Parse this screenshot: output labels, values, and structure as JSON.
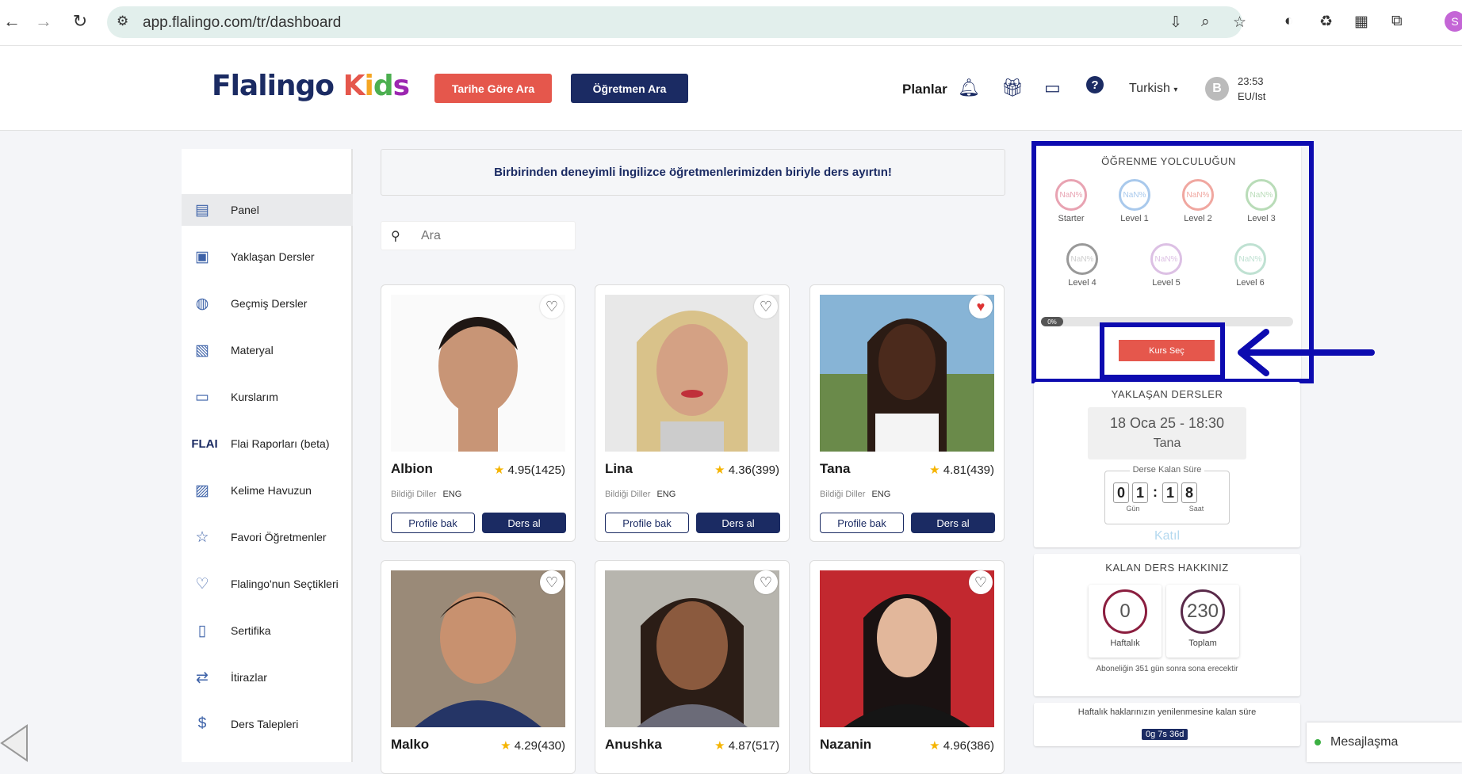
{
  "browser": {
    "url": "app.flalingo.com/tr/dashboard",
    "profile_initial": "S"
  },
  "header": {
    "logo": "Flalingo Kids",
    "btn_date_search": "Tarihe Göre Ara",
    "btn_teacher_search": "Öğretmen Ara",
    "plans": "Planlar",
    "language": "Turkish",
    "avatar_initial": "B",
    "time": "23:53",
    "timezone": "EU/Ist"
  },
  "sidebar": {
    "items": [
      {
        "label": "Panel",
        "icon": "panel-icon"
      },
      {
        "label": "Yaklaşan Dersler",
        "icon": "upcoming-icon"
      },
      {
        "label": "Geçmiş Dersler",
        "icon": "globe-icon"
      },
      {
        "label": "Materyal",
        "icon": "material-icon"
      },
      {
        "label": "Kurslarım",
        "icon": "courses-icon"
      },
      {
        "label": "Flai Raporları (beta)",
        "icon": "flai-logo",
        "logo_text": "FLAI"
      },
      {
        "label": "Kelime Havuzun",
        "icon": "words-icon"
      },
      {
        "label": "Favori Öğretmenler",
        "icon": "favorite-icon"
      },
      {
        "label": "Flalingo'nun Seçtikleri",
        "icon": "picks-icon"
      },
      {
        "label": "Sertifika",
        "icon": "certificate-icon"
      },
      {
        "label": "İtirazlar",
        "icon": "objection-icon"
      },
      {
        "label": "Ders Talepleri",
        "icon": "request-icon"
      }
    ]
  },
  "main": {
    "banner": "Birbirinden deneyimli İngilizce öğretmenlerimizden biriyle ders ayırtın!",
    "search_placeholder": "Ara",
    "languages_label": "Bildiği Diller",
    "profile_btn": "Profile bak",
    "book_btn": "Ders al",
    "teachers": [
      {
        "name": "Albion",
        "rating": "4.95(1425)",
        "lang": "ENG",
        "favorite": false
      },
      {
        "name": "Lina",
        "rating": "4.36(399)",
        "lang": "ENG",
        "favorite": false
      },
      {
        "name": "Tana",
        "rating": "4.81(439)",
        "lang": "ENG",
        "favorite": true
      },
      {
        "name": "Malko",
        "rating": "4.29(430)",
        "favorite": false
      },
      {
        "name": "Anushka",
        "rating": "4.87(517)",
        "favorite": false
      },
      {
        "name": "Nazanin",
        "rating": "4.96(386)",
        "favorite": false
      }
    ]
  },
  "journey": {
    "title": "ÖĞRENME YOLCULUĞUN",
    "levels": [
      {
        "label": "Starter",
        "value": "NaN%",
        "color": "#e8a3b2"
      },
      {
        "label": "Level 1",
        "value": "NaN%",
        "color": "#a9c9ec"
      },
      {
        "label": "Level 2",
        "value": "NaN%",
        "color": "#f0a7a0"
      },
      {
        "label": "Level 3",
        "value": "NaN%",
        "color": "#b9dcb8"
      },
      {
        "label": "Level 4",
        "value": "NaN%",
        "color": "#999999"
      },
      {
        "label": "Level 5",
        "value": "NaN%",
        "color": "#dcc0e4"
      },
      {
        "label": "Level 6",
        "value": "NaN%",
        "color": "#bfe1d2"
      }
    ],
    "progress": "0%",
    "button": "Kurs Seç"
  },
  "upcoming": {
    "title": "YAKLAŞAN DERSLER",
    "date": "18 Oca 25 - 18:30",
    "teacher": "Tana",
    "countdown_title": "Derse Kalan Süre",
    "days": [
      "0",
      "1"
    ],
    "hours": [
      "1",
      "8"
    ],
    "days_label": "Gün",
    "hours_label": "Saat",
    "join": "Katıl"
  },
  "credits": {
    "title": "KALAN DERS HAKKINIZ",
    "weekly": "0",
    "weekly_label": "Haftalık",
    "total": "230",
    "total_label": "Toplam",
    "note": "Aboneliğin 351 gün sonra sona erecektir"
  },
  "renew": {
    "text": "Haftalık haklarınızın yenilenmesine kalan süre",
    "value": "0g 7s 36d"
  },
  "messaging": {
    "label": "Mesajlaşma"
  },
  "colors": {
    "navy": "#1b2b63",
    "red": "#e5574c",
    "highlight": "#0d0bb0"
  }
}
